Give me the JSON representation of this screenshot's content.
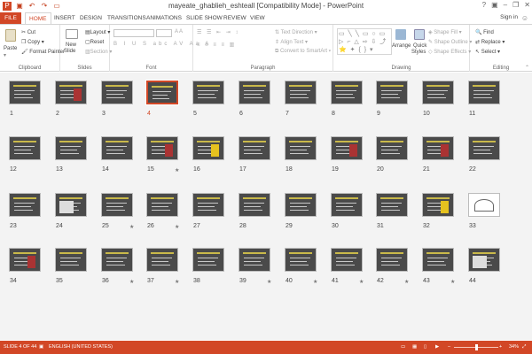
{
  "titlebar": {
    "title": "mayeate_ghablieh_eshteall [Compatibility Mode] - PowerPoint"
  },
  "tabs": [
    {
      "label": "FILE"
    },
    {
      "label": "HOME"
    },
    {
      "label": "INSERT"
    },
    {
      "label": "DESIGN"
    },
    {
      "label": "TRANSITIONS"
    },
    {
      "label": "ANIMATIONS"
    },
    {
      "label": "SLIDE SHOW"
    },
    {
      "label": "REVIEW"
    },
    {
      "label": "VIEW"
    }
  ],
  "account": {
    "signin": "Sign in"
  },
  "ribbon": {
    "clipboard": {
      "paste": "Paste",
      "cut": "Cut",
      "copy": "Copy",
      "format_painter": "Format Painter",
      "label": "Clipboard"
    },
    "slides": {
      "new_slide": "New",
      "new_slide_2": "Slide",
      "layout": "Layout",
      "reset": "Reset",
      "section": "Section",
      "label": "Slides"
    },
    "font": {
      "label": "Font"
    },
    "paragraph": {
      "text_direction": "Text Direction",
      "align_text": "Align Text",
      "convert": "Convert to SmartArt",
      "label": "Paragraph"
    },
    "drawing": {
      "arrange": "Arrange",
      "quick_styles": "Quick",
      "quick_styles_2": "Styles",
      "shape_fill": "Shape Fill",
      "shape_outline": "Shape Outline",
      "shape_effects": "Shape Effects",
      "label": "Drawing"
    },
    "editing": {
      "find": "Find",
      "replace": "Replace",
      "select": "Select",
      "label": "Editing"
    }
  },
  "slides": [
    {
      "n": "1",
      "kind": "title"
    },
    {
      "n": "2",
      "kind": "pic"
    },
    {
      "n": "3",
      "kind": "text"
    },
    {
      "n": "4",
      "kind": "table",
      "selected": true
    },
    {
      "n": "5",
      "kind": "text"
    },
    {
      "n": "6",
      "kind": "text"
    },
    {
      "n": "7",
      "kind": "text"
    },
    {
      "n": "8",
      "kind": "title"
    },
    {
      "n": "9",
      "kind": "text"
    },
    {
      "n": "10",
      "kind": "text"
    },
    {
      "n": "11",
      "kind": "text"
    },
    {
      "n": "12",
      "kind": "text"
    },
    {
      "n": "13",
      "kind": "text"
    },
    {
      "n": "14",
      "kind": "text"
    },
    {
      "n": "15",
      "kind": "pic",
      "star": true
    },
    {
      "n": "16",
      "kind": "picy"
    },
    {
      "n": "17",
      "kind": "text"
    },
    {
      "n": "18",
      "kind": "text"
    },
    {
      "n": "19",
      "kind": "pic"
    },
    {
      "n": "20",
      "kind": "text"
    },
    {
      "n": "21",
      "kind": "pic"
    },
    {
      "n": "22",
      "kind": "text"
    },
    {
      "n": "23",
      "kind": "title"
    },
    {
      "n": "24",
      "kind": "picw"
    },
    {
      "n": "25",
      "kind": "text",
      "star": true
    },
    {
      "n": "26",
      "kind": "text",
      "star": true
    },
    {
      "n": "27",
      "kind": "text"
    },
    {
      "n": "28",
      "kind": "text"
    },
    {
      "n": "29",
      "kind": "text"
    },
    {
      "n": "30",
      "kind": "text"
    },
    {
      "n": "31",
      "kind": "text"
    },
    {
      "n": "32",
      "kind": "picy"
    },
    {
      "n": "33",
      "kind": "white"
    },
    {
      "n": "34",
      "kind": "pic"
    },
    {
      "n": "35",
      "kind": "text"
    },
    {
      "n": "36",
      "kind": "text",
      "star": true
    },
    {
      "n": "37",
      "kind": "text",
      "star": true
    },
    {
      "n": "38",
      "kind": "text"
    },
    {
      "n": "39",
      "kind": "text",
      "star": true
    },
    {
      "n": "40",
      "kind": "text",
      "star": true
    },
    {
      "n": "41",
      "kind": "text",
      "star": true
    },
    {
      "n": "42",
      "kind": "text",
      "star": true
    },
    {
      "n": "43",
      "kind": "text",
      "star": true
    },
    {
      "n": "44",
      "kind": "picw"
    }
  ],
  "status": {
    "slide_info": "SLIDE 4 OF 44",
    "language": "ENGLISH (UNITED STATES)",
    "zoom": "34%",
    "zoom_fraction": 0.34
  },
  "colors": {
    "accent": "#d24726",
    "background": "#f3f3f3"
  }
}
